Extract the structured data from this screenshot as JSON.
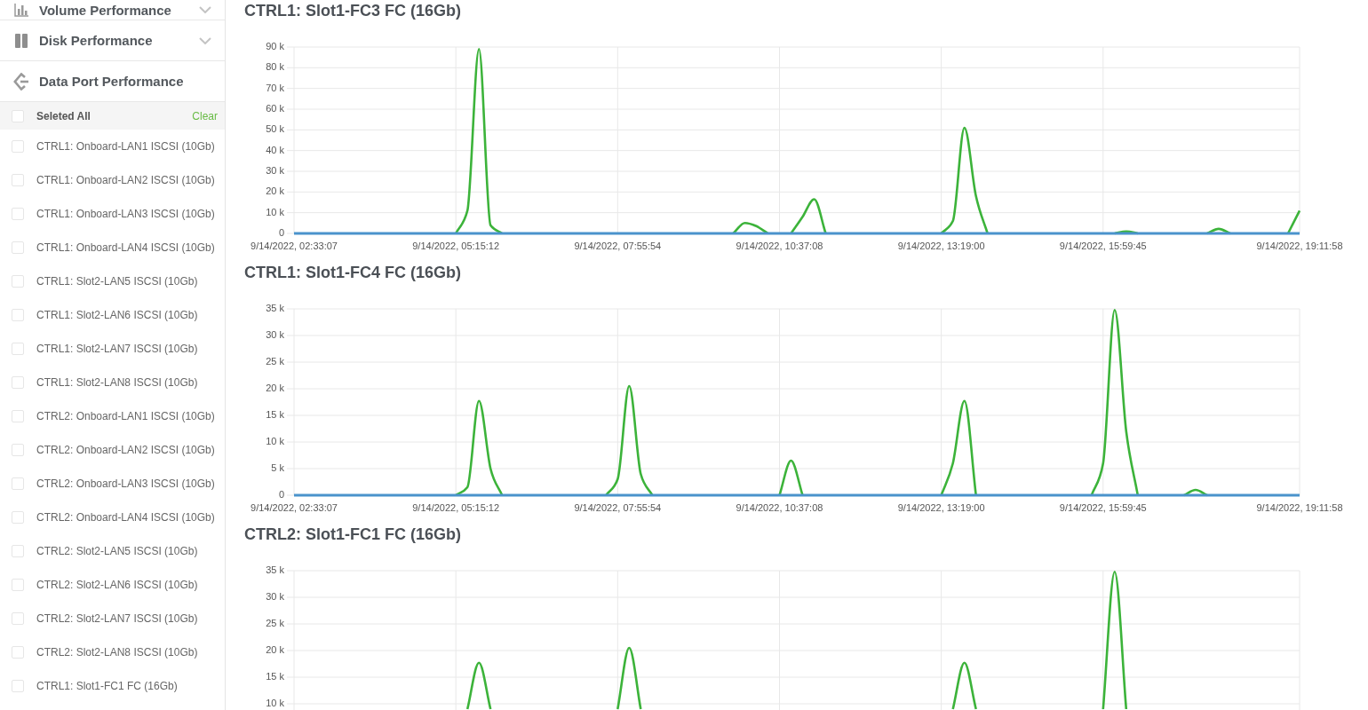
{
  "sidebar": {
    "sections": [
      {
        "kind": "volume",
        "title": "Volume Performance",
        "expanded": false
      },
      {
        "kind": "disk",
        "title": "Disk Performance",
        "expanded": false
      },
      {
        "kind": "port",
        "title": "Data Port Performance",
        "expanded": true,
        "select_all": {
          "label": "Seleted All",
          "checked": false
        },
        "clear": "Clear",
        "items": [
          {
            "label": "CTRL1: Onboard-LAN1 ISCSI (10Gb)",
            "checked": false
          },
          {
            "label": "CTRL1: Onboard-LAN2 ISCSI (10Gb)",
            "checked": false
          },
          {
            "label": "CTRL1: Onboard-LAN3 ISCSI (10Gb)",
            "checked": false
          },
          {
            "label": "CTRL1: Onboard-LAN4 ISCSI (10Gb)",
            "checked": false
          },
          {
            "label": "CTRL1: Slot2-LAN5 ISCSI (10Gb)",
            "checked": false
          },
          {
            "label": "CTRL1: Slot2-LAN6 ISCSI (10Gb)",
            "checked": false
          },
          {
            "label": "CTRL1: Slot2-LAN7 ISCSI (10Gb)",
            "checked": false
          },
          {
            "label": "CTRL1: Slot2-LAN8 ISCSI (10Gb)",
            "checked": false
          },
          {
            "label": "CTRL2: Onboard-LAN1 ISCSI (10Gb)",
            "checked": false
          },
          {
            "label": "CTRL2: Onboard-LAN2 ISCSI (10Gb)",
            "checked": false
          },
          {
            "label": "CTRL2: Onboard-LAN3 ISCSI (10Gb)",
            "checked": false
          },
          {
            "label": "CTRL2: Onboard-LAN4 ISCSI (10Gb)",
            "checked": false
          },
          {
            "label": "CTRL2: Slot2-LAN5 ISCSI (10Gb)",
            "checked": false
          },
          {
            "label": "CTRL2: Slot2-LAN6 ISCSI (10Gb)",
            "checked": false
          },
          {
            "label": "CTRL2: Slot2-LAN7 ISCSI (10Gb)",
            "checked": false
          },
          {
            "label": "CTRL2: Slot2-LAN8 ISCSI (10Gb)",
            "checked": false
          },
          {
            "label": "CTRL1: Slot1-FC1 FC (16Gb)",
            "checked": false
          }
        ]
      }
    ]
  },
  "charts": [
    {
      "title": "CTRL1: Slot1-FC3 FC (16Gb)",
      "chart_data": {
        "type": "line",
        "grid": true,
        "categories": [
          "9/14/2022, 02:33:07",
          null,
          null,
          null,
          null,
          null,
          null,
          null,
          null,
          null,
          null,
          null,
          null,
          null,
          "9/14/2022, 05:15:12",
          null,
          null,
          null,
          null,
          null,
          null,
          null,
          null,
          null,
          null,
          null,
          null,
          null,
          "9/14/2022, 07:55:54",
          null,
          null,
          null,
          null,
          null,
          null,
          null,
          null,
          null,
          null,
          null,
          null,
          null,
          "9/14/2022, 10:37:08",
          null,
          null,
          null,
          null,
          null,
          null,
          null,
          null,
          null,
          null,
          null,
          null,
          null,
          "9/14/2022, 13:19:00",
          null,
          null,
          null,
          null,
          null,
          null,
          null,
          null,
          null,
          null,
          null,
          null,
          null,
          "9/14/2022, 15:59:45",
          null,
          null,
          null,
          null,
          null,
          null,
          null,
          null,
          null,
          null,
          null,
          null,
          null,
          null,
          null,
          null,
          "9/14/2022, 19:11:58"
        ],
        "series": [
          {
            "color": "#3cb33a",
            "values": [
              null,
              null,
              null,
              null,
              null,
              null,
              null,
              null,
              null,
              null,
              null,
              null,
              null,
              null,
              0,
              11000,
              89000,
              4000,
              0,
              null,
              null,
              null,
              null,
              null,
              null,
              null,
              null,
              null,
              null,
              null,
              null,
              null,
              null,
              null,
              null,
              null,
              null,
              null,
              0,
              5000,
              3500,
              0,
              null,
              0,
              8000,
              16500,
              0,
              null,
              null,
              null,
              null,
              null,
              null,
              null,
              null,
              null,
              0,
              6000,
              51000,
              18000,
              0,
              null,
              null,
              null,
              null,
              null,
              null,
              null,
              null,
              null,
              null,
              0,
              1000,
              0,
              null,
              null,
              null,
              null,
              null,
              0,
              2200,
              0,
              null,
              null,
              null,
              null,
              0,
              11000
            ]
          },
          {
            "color": "#4a93cc",
            "values": [
              0,
              0,
              0,
              0,
              0,
              0,
              0,
              0,
              0,
              0,
              0,
              0,
              0,
              0,
              0,
              0,
              0,
              0,
              0,
              0,
              0,
              0,
              0,
              0,
              0,
              0,
              0,
              0,
              0,
              0,
              0,
              0,
              0,
              0,
              0,
              0,
              0,
              0,
              0,
              0,
              0,
              0,
              0,
              0,
              0,
              0,
              0,
              0,
              0,
              0,
              0,
              0,
              0,
              0,
              0,
              0,
              0,
              0,
              0,
              0,
              0,
              0,
              0,
              0,
              0,
              0,
              0,
              0,
              0,
              0,
              0,
              0,
              0,
              0,
              0,
              0,
              0,
              0,
              0,
              0,
              0,
              0,
              0,
              0,
              0,
              0,
              0,
              0
            ]
          }
        ],
        "ylim": [
          0,
          90000
        ],
        "yticks": [
          {
            "value": 0,
            "label": "0"
          },
          {
            "value": 10000,
            "label": "10 k"
          },
          {
            "value": 20000,
            "label": "20 k"
          },
          {
            "value": 30000,
            "label": "30 k"
          },
          {
            "value": 40000,
            "label": "40 k"
          },
          {
            "value": 50000,
            "label": "50 k"
          },
          {
            "value": 60000,
            "label": "60 k"
          },
          {
            "value": 70000,
            "label": "70 k"
          },
          {
            "value": 80000,
            "label": "80 k"
          },
          {
            "value": 90000,
            "label": "90 k"
          }
        ]
      }
    },
    {
      "title": "CTRL1: Slot1-FC4 FC (16Gb)",
      "chart_data": {
        "type": "line",
        "grid": true,
        "categories": [
          "9/14/2022, 02:33:07",
          null,
          null,
          null,
          null,
          null,
          null,
          null,
          null,
          null,
          null,
          null,
          null,
          null,
          "9/14/2022, 05:15:12",
          null,
          null,
          null,
          null,
          null,
          null,
          null,
          null,
          null,
          null,
          null,
          null,
          null,
          "9/14/2022, 07:55:54",
          null,
          null,
          null,
          null,
          null,
          null,
          null,
          null,
          null,
          null,
          null,
          null,
          null,
          "9/14/2022, 10:37:08",
          null,
          null,
          null,
          null,
          null,
          null,
          null,
          null,
          null,
          null,
          null,
          null,
          null,
          "9/14/2022, 13:19:00",
          null,
          null,
          null,
          null,
          null,
          null,
          null,
          null,
          null,
          null,
          null,
          null,
          null,
          "9/14/2022, 15:59:45",
          null,
          null,
          null,
          null,
          null,
          null,
          null,
          null,
          null,
          null,
          null,
          null,
          null,
          null,
          null,
          null,
          "9/14/2022, 19:11:58"
        ],
        "series": [
          {
            "color": "#3cb33a",
            "values": [
              null,
              null,
              null,
              null,
              null,
              null,
              null,
              null,
              null,
              null,
              null,
              null,
              null,
              null,
              0,
              1500,
              17700,
              5000,
              0,
              null,
              null,
              null,
              null,
              null,
              null,
              null,
              null,
              0,
              3000,
              20500,
              4000,
              0,
              null,
              null,
              null,
              null,
              null,
              null,
              null,
              null,
              null,
              null,
              0,
              6500,
              0,
              null,
              null,
              null,
              null,
              null,
              null,
              null,
              null,
              null,
              null,
              null,
              0,
              6000,
              17700,
              0,
              null,
              null,
              null,
              null,
              null,
              null,
              null,
              null,
              null,
              0,
              6000,
              34800,
              12000,
              0,
              null,
              null,
              null,
              0,
              1000,
              0,
              null,
              null,
              null,
              null,
              null,
              null,
              null,
              null
            ]
          },
          {
            "color": "#4a93cc",
            "values": [
              0,
              0,
              0,
              0,
              0,
              0,
              0,
              0,
              0,
              0,
              0,
              0,
              0,
              0,
              0,
              0,
              0,
              0,
              0,
              0,
              0,
              0,
              0,
              0,
              0,
              0,
              0,
              0,
              0,
              0,
              0,
              0,
              0,
              0,
              0,
              0,
              0,
              0,
              0,
              0,
              0,
              0,
              0,
              0,
              0,
              0,
              0,
              0,
              0,
              0,
              0,
              0,
              0,
              0,
              0,
              0,
              0,
              0,
              0,
              0,
              0,
              0,
              0,
              0,
              0,
              0,
              0,
              0,
              0,
              0,
              0,
              0,
              0,
              0,
              0,
              0,
              0,
              0,
              0,
              0,
              0,
              0,
              0,
              0,
              0,
              0,
              0,
              0
            ]
          }
        ],
        "ylim": [
          0,
          35000
        ],
        "yticks": [
          {
            "value": 0,
            "label": "0"
          },
          {
            "value": 5000,
            "label": "5 k"
          },
          {
            "value": 10000,
            "label": "10 k"
          },
          {
            "value": 15000,
            "label": "15 k"
          },
          {
            "value": 20000,
            "label": "20 k"
          },
          {
            "value": 25000,
            "label": "25 k"
          },
          {
            "value": 30000,
            "label": "30 k"
          },
          {
            "value": 35000,
            "label": "35 k"
          }
        ]
      }
    },
    {
      "title": "CTRL2: Slot1-FC1 FC (16Gb)",
      "chart_data": {
        "type": "line",
        "grid": true,
        "series": [
          {
            "color": "#3cb33a",
            "values": [
              null,
              null,
              null,
              null,
              null,
              null,
              null,
              null,
              null,
              null,
              null,
              null,
              null,
              null,
              null,
              9000,
              17700,
              9000,
              null,
              null,
              null,
              null,
              null,
              null,
              null,
              null,
              null,
              null,
              9000,
              20500,
              9000,
              null,
              null,
              null,
              null,
              null,
              null,
              null,
              null,
              null,
              null,
              null,
              null,
              null,
              null,
              null,
              null,
              null,
              null,
              null,
              null,
              null,
              null,
              null,
              null,
              null,
              null,
              9000,
              17700,
              9000,
              null,
              null,
              null,
              null,
              null,
              null,
              null,
              null,
              null,
              null,
              9000,
              34800,
              9000,
              null,
              null,
              null,
              null,
              null,
              null,
              null,
              null,
              null,
              null,
              null,
              null,
              null,
              null,
              null
            ]
          }
        ],
        "ylim": [
          0,
          35000
        ],
        "yticks": [
          {
            "value": 10000,
            "label": "10 k"
          },
          {
            "value": 15000,
            "label": "15 k"
          },
          {
            "value": 20000,
            "label": "20 k"
          },
          {
            "value": 25000,
            "label": "25 k"
          },
          {
            "value": 30000,
            "label": "30 k"
          },
          {
            "value": 35000,
            "label": "35 k"
          }
        ]
      }
    }
  ]
}
